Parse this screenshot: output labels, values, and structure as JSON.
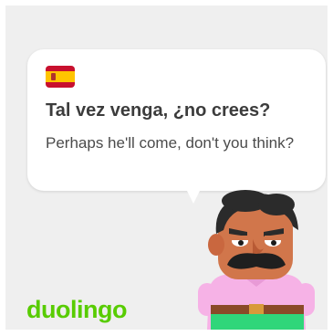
{
  "card": {
    "bubble": {
      "flag_icon": "spain-flag-icon",
      "headline": "Tal vez venga, ¿no crees?",
      "translation": "Perhaps he'll come, don't you think?"
    },
    "brand": {
      "logo_text": "duolingo",
      "color": "#58cc02"
    },
    "character_icon": "mustached-man-character"
  }
}
